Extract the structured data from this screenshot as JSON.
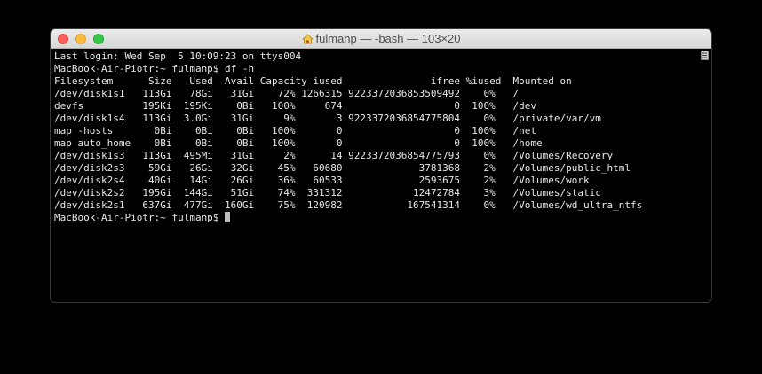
{
  "window": {
    "title": "fulmanp — -bash — 103×20",
    "colors": {
      "close": "#fc605c",
      "minimize": "#fdbc40",
      "maximize": "#34c84a",
      "background": "#000000",
      "text": "#e8e8e8"
    }
  },
  "terminal": {
    "lines": [
      "Last login: Wed Sep  5 10:09:23 on ttys004",
      "MacBook-Air-Piotr:~ fulmanp$ df -h",
      "Filesystem      Size   Used  Avail Capacity iused               ifree %iused  Mounted on",
      "/dev/disk1s1   113Gi   78Gi   31Gi    72% 1266315 9223372036853509492    0%   /",
      "devfs          195Ki  195Ki    0Bi   100%     674                   0  100%   /dev",
      "/dev/disk1s4   113Gi  3.0Gi   31Gi     9%       3 9223372036854775804    0%   /private/var/vm",
      "map -hosts       0Bi    0Bi    0Bi   100%       0                   0  100%   /net",
      "map auto_home    0Bi    0Bi    0Bi   100%       0                   0  100%   /home",
      "/dev/disk1s3   113Gi  495Mi   31Gi     2%      14 9223372036854775793    0%   /Volumes/Recovery",
      "/dev/disk2s3    59Gi   26Gi   32Gi    45%   60680             3781368    2%   /Volumes/public_html",
      "/dev/disk2s4    40Gi   14Gi   26Gi    36%   60533             2593675    2%   /Volumes/work",
      "/dev/disk2s2   195Gi  144Gi   51Gi    74%  331312            12472784    3%   /Volumes/static",
      "/dev/disk2s1   637Gi  477Gi  160Gi    75%  120982           167541314    0%   /Volumes/wd_ultra_ntfs"
    ],
    "prompt": "MacBook-Air-Piotr:~ fulmanp$ "
  },
  "icons": {
    "title": "home-icon",
    "scrollbar": "scroll-lines-icon"
  }
}
